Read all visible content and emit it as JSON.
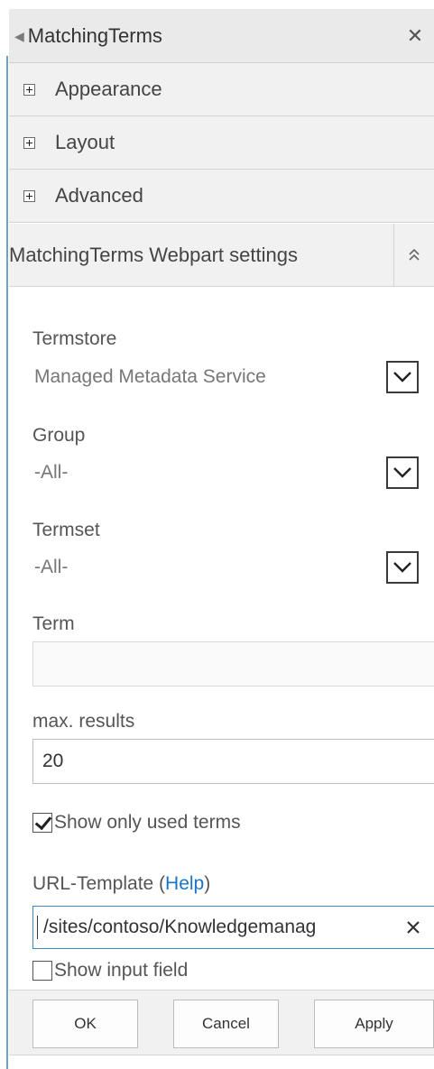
{
  "panel": {
    "title": "MatchingTerms",
    "close_glyph": "✕"
  },
  "sections": {
    "appearance": "Appearance",
    "layout": "Layout",
    "advanced": "Advanced",
    "settings": "MatchingTerms Webpart settings"
  },
  "form": {
    "termstore": {
      "label": "Termstore",
      "value": "Managed Metadata Service"
    },
    "group": {
      "label": "Group",
      "value": "-All-"
    },
    "termset": {
      "label": "Termset",
      "value": "-All-"
    },
    "term": {
      "label": "Term",
      "value": ""
    },
    "max_results": {
      "label": "max. results",
      "value": "20"
    },
    "show_only_used": {
      "label": "Show only used terms",
      "checked": true
    },
    "url_template": {
      "label": "URL-Template (",
      "help": "Help",
      "label_end": ")",
      "value": "/sites/contoso/Knowledgemanag"
    },
    "show_input": {
      "label": "Show input field",
      "checked": false
    }
  },
  "buttons": {
    "ok": "OK",
    "cancel": "Cancel",
    "apply": "Apply"
  },
  "colors": {
    "accent": "#1a74c6",
    "focus_border": "#3d86c8"
  }
}
